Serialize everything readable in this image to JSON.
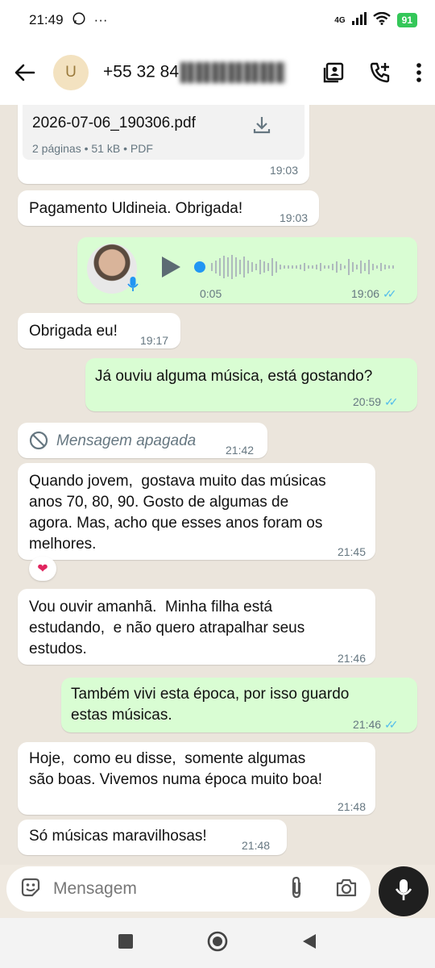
{
  "status": {
    "time": "21:49",
    "dots": "···",
    "network": "4G",
    "battery": "91"
  },
  "header": {
    "avatar_letter": "U",
    "contact": "+55 32 84"
  },
  "messages": {
    "pdf": {
      "filename": "2026-07-06_190306.pdf",
      "meta": "2 páginas • 51 kB • PDF",
      "time": "19:03"
    },
    "m1": {
      "text": "Pagamento Uldineia. Obrigada!",
      "time": "19:03"
    },
    "audio": {
      "duration": "0:05",
      "time": "19:06"
    },
    "m2": {
      "text": "Obrigada eu!",
      "time": "19:17"
    },
    "m3": {
      "text": "Já ouviu alguma música, está gostando?",
      "time": "20:59"
    },
    "m4": {
      "text": "Mensagem apagada",
      "time": "21:42"
    },
    "m5": {
      "line1": "Quando jovem,  gostava muito das músicas",
      "line2": "anos 70, 80, 90. Gosto de algumas de",
      "line3": "agora. Mas, acho que esses anos foram os",
      "line4": "melhores.",
      "time": "21:45",
      "reaction": "❤"
    },
    "m6": {
      "line1": "Vou ouvir amanhã.  Minha filha está",
      "line2": "estudando,  e não quero atrapalhar seus",
      "line3": "estudos.",
      "time": "21:46"
    },
    "m7": {
      "line1": "Também vivi esta época, por isso guardo",
      "line2": "estas músicas.",
      "time": "21:46"
    },
    "m8": {
      "line1": "Hoje,  como eu disse,  somente algumas",
      "line2": "são boas. Vivemos numa época muito boa!",
      "time": "21:48"
    },
    "m9": {
      "text": "Só músicas maravilhosas!",
      "time": "21:48"
    }
  },
  "input": {
    "placeholder": "Mensagem"
  },
  "icons": {
    "back": "arrow-left-icon",
    "contact_card": "contact-card-icon",
    "add_call": "add-call-icon",
    "menu": "more-vert-icon",
    "download": "download-icon",
    "play": "play-icon",
    "mic": "mic-icon",
    "sticker": "sticker-icon",
    "attach": "paperclip-icon",
    "camera": "camera-icon",
    "deleted": "block-icon"
  },
  "colors": {
    "outgoing": "#d9fdd3",
    "incoming": "#ffffff",
    "ticks": "#53bdeb",
    "background": "#ebe5dc"
  }
}
